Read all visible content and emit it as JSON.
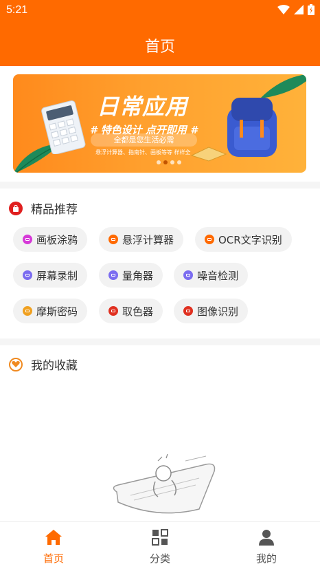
{
  "status_bar": {
    "time": "5:21"
  },
  "header": {
    "title": "首页"
  },
  "banner": {
    "headline": "日常应用",
    "tagline": "# 特色设计 点开即用 #",
    "pill": "全都是您生活必需",
    "small_text": "悬浮计算器、指南针、画板等等 样样全",
    "active_dot": 1,
    "dot_count": 4
  },
  "featured": {
    "title": "精品推荐",
    "icon": "bag-icon",
    "accent": "#e02020",
    "items": [
      {
        "label": "画板涂鸦",
        "icon": "palette-icon",
        "color": "#d63ad8"
      },
      {
        "label": "悬浮计算器",
        "icon": "calculator-icon",
        "color": "#ff6a00"
      },
      {
        "label": "OCR文字识别",
        "icon": "ocr-icon",
        "color": "#ff6a00"
      },
      {
        "label": "屏幕录制",
        "icon": "screen-record-icon",
        "color": "#7b6cf0"
      },
      {
        "label": "量角器",
        "icon": "protractor-icon",
        "color": "#7b6cf0"
      },
      {
        "label": "噪音检测",
        "icon": "noise-icon",
        "color": "#7b6cf0"
      },
      {
        "label": "摩斯密码",
        "icon": "morse-icon",
        "color": "#f0a020"
      },
      {
        "label": "取色器",
        "icon": "color-picker-icon",
        "color": "#e03020"
      },
      {
        "label": "图像识别",
        "icon": "image-recognition-icon",
        "color": "#e03020"
      }
    ]
  },
  "favorites": {
    "title": "我的收藏",
    "icon": "heart-icon",
    "accent": "#f08a20"
  },
  "tabbar": {
    "active_color": "#ff6a00",
    "items": [
      {
        "label": "首页",
        "icon": "home-icon",
        "active": true
      },
      {
        "label": "分类",
        "icon": "category-icon",
        "active": false
      },
      {
        "label": "我的",
        "icon": "profile-icon",
        "active": false
      }
    ]
  }
}
